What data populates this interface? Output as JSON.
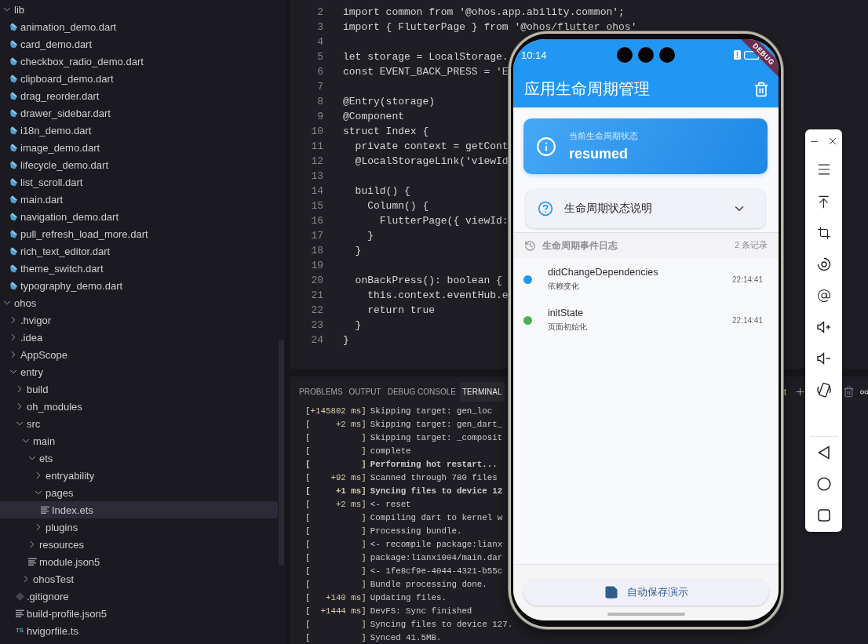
{
  "explorer": {
    "tree": [
      {
        "kind": "folder",
        "label": "lib",
        "expanded": true,
        "selected": false,
        "children": [
          {
            "kind": "dart",
            "label": "animation_demo.dart",
            "selected": false
          },
          {
            "kind": "dart",
            "label": "card_demo.dart",
            "selected": false
          },
          {
            "kind": "dart",
            "label": "checkbox_radio_demo.dart",
            "selected": false
          },
          {
            "kind": "dart",
            "label": "clipboard_demo.dart",
            "selected": false
          },
          {
            "kind": "dart",
            "label": "drag_reorder.dart",
            "selected": false
          },
          {
            "kind": "dart",
            "label": "drawer_sidebar.dart",
            "selected": false
          },
          {
            "kind": "dart",
            "label": "i18n_demo.dart",
            "selected": false
          },
          {
            "kind": "dart",
            "label": "image_demo.dart",
            "selected": false
          },
          {
            "kind": "dart",
            "label": "lifecycle_demo.dart",
            "selected": false
          },
          {
            "kind": "dart",
            "label": "list_scroll.dart",
            "selected": false
          },
          {
            "kind": "dart",
            "label": "main.dart",
            "selected": false
          },
          {
            "kind": "dart",
            "label": "navigation_demo.dart",
            "selected": false
          },
          {
            "kind": "dart",
            "label": "pull_refresh_load_more.dart",
            "selected": false
          },
          {
            "kind": "dart",
            "label": "rich_text_editor.dart",
            "selected": false
          },
          {
            "kind": "dart",
            "label": "theme_switch.dart",
            "selected": false
          },
          {
            "kind": "dart",
            "label": "typography_demo.dart",
            "selected": false
          }
        ]
      },
      {
        "kind": "folder",
        "label": "ohos",
        "expanded": true,
        "selected": false,
        "children": [
          {
            "kind": "folder",
            "label": ".hvigor",
            "expanded": false,
            "selected": false
          },
          {
            "kind": "folder",
            "label": ".idea",
            "expanded": false,
            "selected": false
          },
          {
            "kind": "folder",
            "label": "AppScope",
            "expanded": false,
            "selected": false
          },
          {
            "kind": "folder",
            "label": "entry",
            "expanded": true,
            "selected": false,
            "children": [
              {
                "kind": "folder",
                "label": "build",
                "expanded": false,
                "selected": false
              },
              {
                "kind": "folder",
                "label": "oh_modules",
                "expanded": false,
                "selected": false
              },
              {
                "kind": "folder",
                "label": "src",
                "expanded": true,
                "selected": false,
                "children": [
                  {
                    "kind": "folder",
                    "label": "main",
                    "expanded": true,
                    "selected": false,
                    "children": [
                      {
                        "kind": "folder",
                        "label": "ets",
                        "expanded": true,
                        "selected": false,
                        "children": [
                          {
                            "kind": "folder",
                            "label": "entryability",
                            "expanded": false,
                            "selected": false
                          },
                          {
                            "kind": "folder",
                            "label": "pages",
                            "expanded": true,
                            "selected": false,
                            "children": [
                              {
                                "kind": "file",
                                "label": "Index.ets",
                                "selected": true
                              }
                            ]
                          },
                          {
                            "kind": "folder",
                            "label": "plugins",
                            "expanded": false,
                            "selected": false
                          }
                        ]
                      },
                      {
                        "kind": "folder",
                        "label": "resources",
                        "expanded": false,
                        "selected": false
                      },
                      {
                        "kind": "file",
                        "label": "module.json5",
                        "selected": false
                      }
                    ]
                  },
                  {
                    "kind": "folder",
                    "label": "ohosTest",
                    "expanded": false,
                    "selected": false
                  }
                ]
              },
              {
                "kind": "git",
                "label": ".gitignore",
                "selected": false
              },
              {
                "kind": "file",
                "label": "build-profile.json5",
                "selected": false
              },
              {
                "kind": "ts",
                "badge": "TS",
                "label": "hvigorfile.ts",
                "selected": false
              }
            ]
          }
        ]
      }
    ]
  },
  "editor": {
    "lines": [
      {
        "number": "2",
        "code": "import common from '@ohos.app.ability.common';"
      },
      {
        "number": "3",
        "code": "import { FlutterPage } from '@ohos/flutter_ohos'"
      },
      {
        "number": "4"
      },
      {
        "number": "5",
        "code": "let storage = LocalStorage."
      },
      {
        "number": "6",
        "code": "const EVENT_BACK_PRESS = 'E"
      },
      {
        "number": "7"
      },
      {
        "number": "8",
        "code": "@Entry(storage)"
      },
      {
        "number": "9",
        "code": "@Component"
      },
      {
        "number": "10",
        "code": "struct Index {"
      },
      {
        "number": "11",
        "code": "  private context = getCont"
      },
      {
        "number": "12",
        "code": "  @LocalStorageLink('viewId"
      },
      {
        "number": "13"
      },
      {
        "number": "14",
        "code": "  build() {"
      },
      {
        "number": "15",
        "code": "    Column() {"
      },
      {
        "number": "16",
        "code": "      FlutterPage({ viewId:"
      },
      {
        "number": "17",
        "code": "    }"
      },
      {
        "number": "18",
        "code": "  }"
      },
      {
        "number": "19"
      },
      {
        "number": "20",
        "code": "  onBackPress(): boolean {"
      },
      {
        "number": "21",
        "code": "    this.context.eventHub.e"
      },
      {
        "number": "22",
        "code": "    return true"
      },
      {
        "number": "23",
        "code": "  }"
      },
      {
        "number": "24",
        "code": "}"
      }
    ]
  },
  "panel": {
    "tabs": [
      {
        "label": "PROBLEMS",
        "selected": false
      },
      {
        "label": "OUTPUT",
        "selected": false
      },
      {
        "label": "DEBUG CONSOLE",
        "selected": false
      },
      {
        "label": "TERMINAL",
        "selected": true
      }
    ],
    "partial_label": "t",
    "terminal": [
      {
        "prefix": "[+145802 ms]",
        "text": "Skipping target: gen_loc",
        "bold": false
      },
      {
        "prefix": "[     +2 ms]",
        "text": "Skipping target: gen_dart_",
        "bold": false
      },
      {
        "prefix": "[          ]",
        "text": "Skipping target: _composit",
        "bold": false
      },
      {
        "prefix": "[          ]",
        "text": "complete",
        "bold": false
      },
      {
        "prefix": "[          ]",
        "text": "Performing hot restart...",
        "bold": true
      },
      {
        "prefix": "[    +92 ms]",
        "text": "Scanned through 780 files",
        "bold": false
      },
      {
        "prefix": "[     +1 ms]",
        "text": "Syncing files to device 12",
        "bold": true
      },
      {
        "prefix": "[     +2 ms]",
        "text": "<- reset",
        "bold": false
      },
      {
        "prefix": "[          ]",
        "text": "Compiling dart to kernel w",
        "bold": false
      },
      {
        "prefix": "[          ]",
        "text": "Processing bundle.",
        "bold": false
      },
      {
        "prefix": "[          ]",
        "text": "<- recompile package:lianx",
        "bold": false
      },
      {
        "prefix": "[          ]",
        "text": "package:lianxi004/main.dar",
        "bold": false
      },
      {
        "prefix": "[          ]",
        "text": "<- 1fe8cf9e-4044-4321-b55c",
        "bold": false
      },
      {
        "prefix": "[          ]",
        "text": "Bundle processing done.",
        "bold": false
      },
      {
        "prefix": "[   +140 ms]",
        "text": "Updating files.",
        "bold": false
      },
      {
        "prefix": "[  +1444 ms]",
        "text": "DevFS: Sync finished",
        "bold": false
      },
      {
        "prefix": "[          ]",
        "text": "Syncing files to device 127.",
        "bold": false
      },
      {
        "prefix": "[          ]",
        "text": "Synced 41.5MB.",
        "bold": false
      }
    ]
  },
  "emulator": {
    "status_bar": {
      "time": "10:14"
    },
    "debug_banner": "DEBUG",
    "app_bar": {
      "title": "应用生命周期管理"
    },
    "status_card": {
      "label": "当前生命周期状态",
      "value": "resumed"
    },
    "explainer": {
      "title": "生命周期状态说明",
      "expanded": false
    },
    "log": {
      "title": "生命周期事件日志",
      "count": "2 条记录",
      "events": [
        {
          "name": "didChangeDependencies",
          "description": "依赖变化",
          "time": "22:14:41",
          "color": "#2196f3"
        },
        {
          "name": "initState",
          "description": "页面初始化",
          "time": "22:14:41",
          "color": "#4caf50"
        }
      ]
    },
    "bottom_button": {
      "label": "自动保存演示"
    }
  }
}
